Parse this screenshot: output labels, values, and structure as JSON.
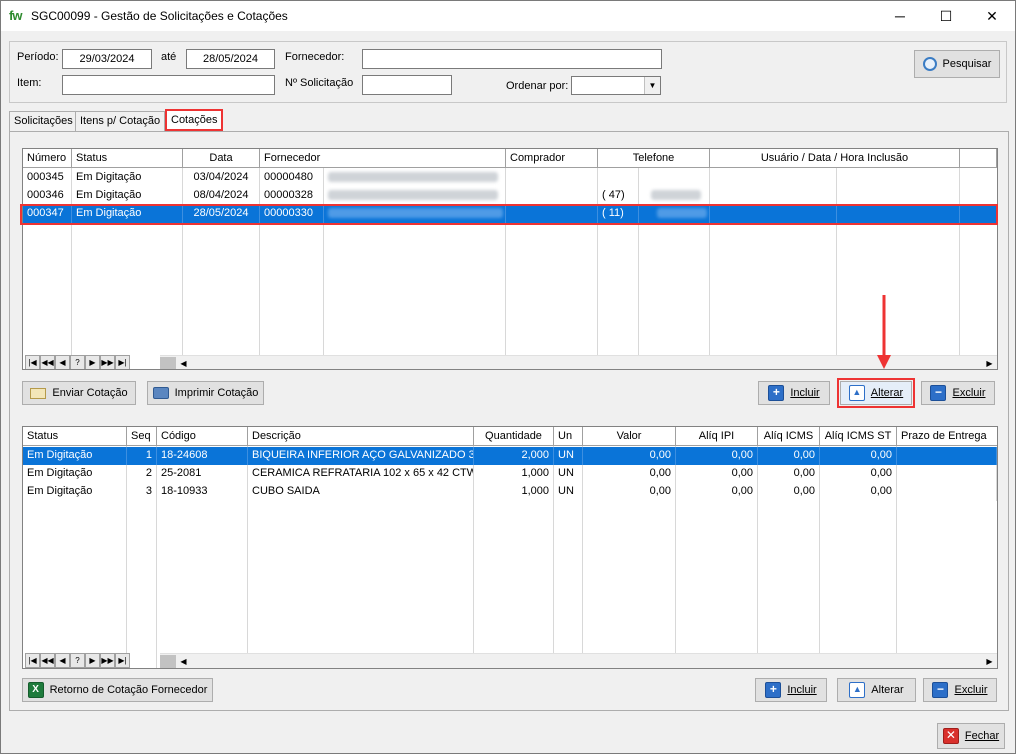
{
  "window": {
    "logo": "fw",
    "title": "SGC00099 - Gestão de Solicitações e Cotações",
    "controls": {
      "minimize": "─",
      "maximize": "☐",
      "close": "✕"
    }
  },
  "filters": {
    "periodo_label": "Período:",
    "periodo_from": "29/03/2024",
    "ate_label": "até",
    "periodo_to": "28/05/2024",
    "fornecedor_label": "Fornecedor:",
    "fornecedor_value": "",
    "item_label": "Item:",
    "item_value": "",
    "nsolicitacao_label": "Nº Solicitação",
    "nsolicitacao_value": "",
    "ordenar_label": "Ordenar por:",
    "ordenar_value": "",
    "pesquisar_label": "Pesquisar"
  },
  "tabs": [
    {
      "label": "Solicitações"
    },
    {
      "label": "Itens p/ Cotação"
    },
    {
      "label": "Cotações",
      "active": true
    }
  ],
  "quotes": {
    "headers": [
      "Número",
      "Status",
      "Data",
      "Fornecedor",
      "Comprador",
      "Telefone",
      "Usuário / Data / Hora Inclusão"
    ],
    "rows": [
      {
        "numero": "000345",
        "status": "Em Digitação",
        "data": "03/04/2024",
        "fornecedor": "00000480",
        "telefone_ddd": "",
        "selected": false
      },
      {
        "numero": "000346",
        "status": "Em Digitação",
        "data": "08/04/2024",
        "fornecedor": "00000328",
        "telefone_ddd": "( 47)",
        "selected": false
      },
      {
        "numero": "000347",
        "status": "Em Digitação",
        "data": "28/05/2024",
        "fornecedor": "00000330",
        "telefone_ddd": "( 11)",
        "selected": true
      }
    ]
  },
  "nav": [
    "|◀",
    "◀◀",
    "◀",
    "?",
    "▶",
    "▶▶",
    "▶|"
  ],
  "quote_actions": {
    "enviar": "Enviar Cotação",
    "imprimir": "Imprimir Cotação",
    "incluir": "Incluir",
    "alterar": "Alterar",
    "excluir": "Excluir"
  },
  "items": {
    "headers": [
      "Status",
      "Seq",
      "Código",
      "Descrição",
      "Quantidade",
      "Un",
      "Valor",
      "Alíq IPI",
      "Alíq ICMS",
      "Alíq ICMS ST",
      "Prazo de Entrega"
    ],
    "rows": [
      {
        "status": "Em Digitação",
        "seq": "1",
        "codigo": "18-24608",
        "descricao": "BIQUEIRA INFERIOR AÇO GALVANIZADO  3",
        "quantidade": "2,000",
        "un": "UN",
        "valor": "0,00",
        "ipi": "0,00",
        "icms": "0,00",
        "icmsst": "0,00",
        "prazo": "",
        "selected": true
      },
      {
        "status": "Em Digitação",
        "seq": "2",
        "codigo": "25-2081",
        "descricao": "CERAMICA REFRATARIA 102 x 65 x 42 CTW",
        "quantidade": "1,000",
        "un": "UN",
        "valor": "0,00",
        "ipi": "0,00",
        "icms": "0,00",
        "icmsst": "0,00",
        "prazo": "",
        "selected": false
      },
      {
        "status": "Em Digitação",
        "seq": "3",
        "codigo": "18-10933",
        "descricao": "CUBO SAIDA",
        "quantidade": "1,000",
        "un": "UN",
        "valor": "0,00",
        "ipi": "0,00",
        "icms": "0,00",
        "icmsst": "0,00",
        "prazo": "",
        "selected": false
      }
    ]
  },
  "item_actions": {
    "retorno": "Retorno de Cotação Fornecedor",
    "incluir": "Incluir",
    "alterar": "Alterar",
    "excluir": "Excluir"
  },
  "footer": {
    "fechar": "Fechar"
  },
  "colors": {
    "selection": "#0a74d8",
    "highlight": "#e33333"
  }
}
